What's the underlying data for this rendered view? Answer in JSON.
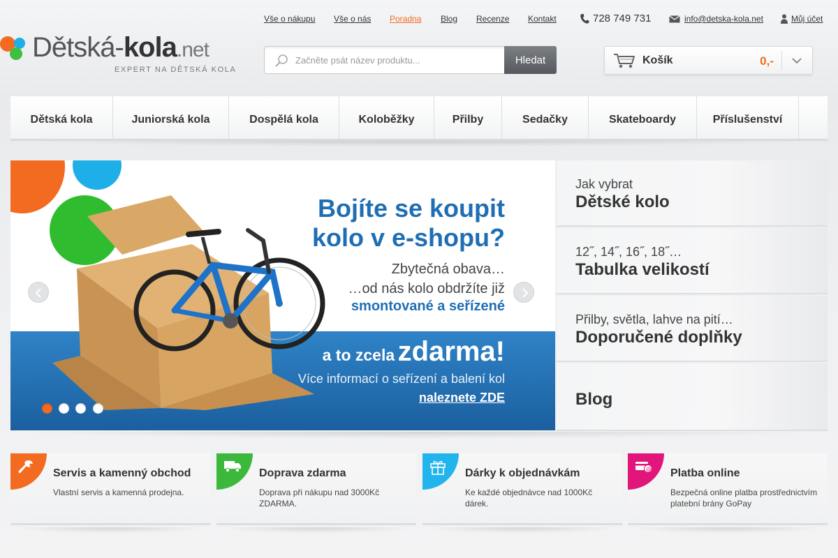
{
  "brand": {
    "logo_prefix": "Dětská-",
    "logo_bold": "kola",
    "logo_suffix": ".net",
    "tagline": "EXPERT NA DĚTSKÁ KOLA"
  },
  "topnav": [
    {
      "label": "Vše o nákupu",
      "active": false
    },
    {
      "label": "Vše o nás",
      "active": false
    },
    {
      "label": "Poradna",
      "active": true
    },
    {
      "label": "Blog",
      "active": false
    },
    {
      "label": "Recenze",
      "active": false
    },
    {
      "label": "Kontakt",
      "active": false
    }
  ],
  "contact": {
    "phone": "728 749 731",
    "email": "info@detska-kola.net",
    "account_label": "Můj účet"
  },
  "search": {
    "placeholder": "Začněte psát název produktu...",
    "button_label": "Hledat"
  },
  "cart": {
    "label": "Košík",
    "price": "0,-"
  },
  "categories": [
    "Dětská kola",
    "Juniorská kola",
    "Dospělá kola",
    "Koloběžky",
    "Přilby",
    "Sedačky",
    "Skateboardy",
    "Příslušenství"
  ],
  "slider": {
    "headline_line1": "Bojíte se koupit",
    "headline_line2": "kolo v e-shopu?",
    "sub_line1": "Zbytečná obava…",
    "sub_line2": "…od nás kolo obdržíte již",
    "highlight": "smontované a seřízené",
    "free_prefix": "a to zcela",
    "free_big": "zdarma!",
    "info_line": "Více informací o seřízení a balení kol",
    "link_label": "naleznete ZDE",
    "slide_count": 4,
    "active_slide": 1
  },
  "side_panels": [
    {
      "small": "Jak vybrat",
      "large": "Dětské kolo"
    },
    {
      "small": "12˝, 14˝, 16˝, 18˝…",
      "large": "Tabulka velikostí"
    },
    {
      "small": "Přilby, světla, lahve na pití…",
      "large": "Doporučené doplňky"
    },
    {
      "small": "",
      "large": "Blog"
    }
  ],
  "features": [
    {
      "title": "Servis a kamenný obchod",
      "desc": "Vlastní servis a kamenná prodejna.",
      "icon": "wrench-icon",
      "color": "#f26b21"
    },
    {
      "title": "Doprava zdarma",
      "desc": "Doprava při nákupu nad 3000Kč ZDARMA.",
      "icon": "truck-icon",
      "color": "#3cb93c"
    },
    {
      "title": "Dárky k objednávkám",
      "desc": "Ke každé objednávce nad 1000Kč dárek.",
      "icon": "gift-icon",
      "color": "#22b4ec"
    },
    {
      "title": "Platba online",
      "desc": "Bezpečná online platba prostřednictvím platební brány GoPay",
      "icon": "card-payment-icon",
      "color": "#e2157a"
    }
  ],
  "colors": {
    "accent_orange": "#f26b21",
    "accent_blue": "#1f6eb4",
    "accent_green": "#3cb93c",
    "accent_cyan": "#22b4ec",
    "accent_magenta": "#e2157a"
  }
}
